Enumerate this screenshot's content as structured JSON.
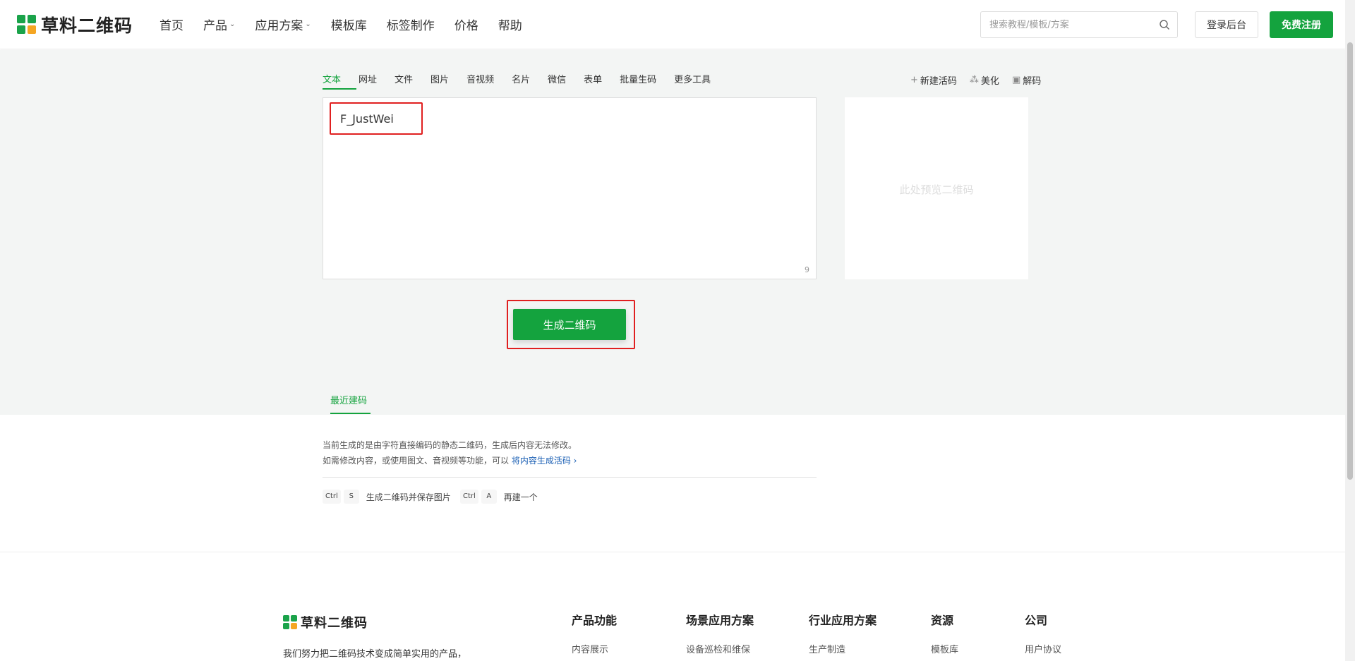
{
  "header": {
    "logo_text": "草料二维码",
    "nav": [
      {
        "label": "首页",
        "has_dropdown": false
      },
      {
        "label": "产品",
        "has_dropdown": true
      },
      {
        "label": "应用方案",
        "has_dropdown": true
      },
      {
        "label": "模板库",
        "has_dropdown": false
      },
      {
        "label": "标签制作",
        "has_dropdown": false
      },
      {
        "label": "价格",
        "has_dropdown": false
      },
      {
        "label": "帮助",
        "has_dropdown": false
      }
    ],
    "search_placeholder": "搜索教程/模板/方案",
    "login_label": "登录后台",
    "register_label": "免费注册"
  },
  "tool_tabs": [
    "文本",
    "网址",
    "文件",
    "图片",
    "音视频",
    "名片",
    "微信",
    "表单",
    "批量生码",
    "更多工具"
  ],
  "active_tab": "文本",
  "right_tools": [
    {
      "icon": "plus-icon",
      "label": "新建活码"
    },
    {
      "icon": "sparkle-icon",
      "label": "美化"
    },
    {
      "icon": "scan-icon",
      "label": "解码"
    }
  ],
  "editor": {
    "value": "F_JustWei",
    "char_count": "9"
  },
  "preview": {
    "placeholder": "此处预览二维码"
  },
  "generate_button": "生成二维码",
  "recent_tab": "最近建码",
  "info": {
    "line1": "当前生成的是由字符直接编码的静态二维码，生成后内容无法修改。",
    "line2_prefix": "如需修改内容，或使用图文、音视频等功能，可以 ",
    "line2_link": "将内容生成活码",
    "line2_chevron": "›"
  },
  "shortcuts": [
    {
      "keys": [
        "Ctrl",
        "S"
      ],
      "label": "生成二维码并保存图片"
    },
    {
      "keys": [
        "Ctrl",
        "A"
      ],
      "label": "再建一个"
    }
  ],
  "footer": {
    "logo_text": "草料二维码",
    "description": "我们努力把二维码技术变成简单实用的产品，",
    "columns": [
      {
        "title": "产品功能",
        "first_link": "内容展示"
      },
      {
        "title": "场景应用方案",
        "first_link": "设备巡检和维保"
      },
      {
        "title": "行业应用方案",
        "first_link": "生产制造"
      },
      {
        "title": "资源",
        "first_link": "模板库"
      },
      {
        "title": "公司",
        "first_link": "用户协议"
      }
    ]
  },
  "colors": {
    "brand_green": "#14a33e",
    "highlight_red": "#e02020",
    "link_blue": "#1a5fb4"
  }
}
